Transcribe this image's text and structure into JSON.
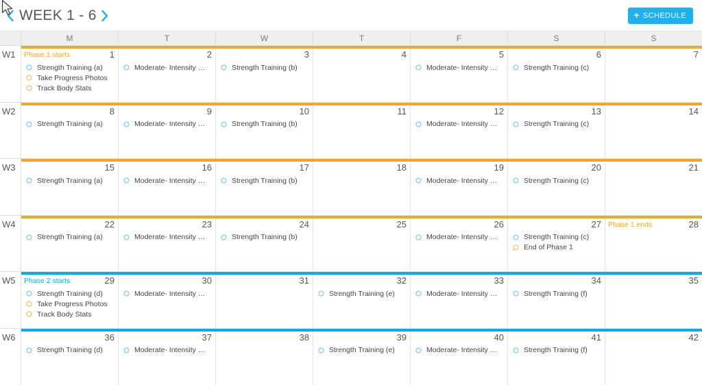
{
  "colors": {
    "phase1": "#F5A623",
    "phase2": "#00AEEF",
    "accent": "#1EB0EF",
    "task_blue": "#5BC8F5",
    "task_orange": "#F5B63F"
  },
  "header": {
    "title": "WEEK 1 - 6",
    "prev_icon": "chevron-left-icon",
    "next_icon": "chevron-right-icon",
    "schedule_label": "SCHEDULE",
    "schedule_plus": "+"
  },
  "calendar": {
    "day_headers": [
      "M",
      "T",
      "W",
      "T",
      "F",
      "S",
      "S"
    ],
    "weeks": [
      {
        "label": "W1",
        "bar_color": "#F5A623",
        "days": [
          {
            "num": "1",
            "phase_label": "Phase 1 starts",
            "phase_color": "#F5A623",
            "events": [
              {
                "label": "Strength Training (a)",
                "icon": "circle-icon",
                "color": "#5BC8F5"
              },
              {
                "label": "Take Progress Photos",
                "icon": "circle-icon",
                "color": "#F5B63F"
              },
              {
                "label": "Track Body Stats",
                "icon": "circle-icon",
                "color": "#F5B63F"
              }
            ]
          },
          {
            "num": "2",
            "events": [
              {
                "label": "Moderate- Intensity …",
                "icon": "circle-icon",
                "color": "#5BC8F5"
              }
            ]
          },
          {
            "num": "3",
            "events": [
              {
                "label": "Strength Training (b)",
                "icon": "circle-icon",
                "color": "#5BC8F5"
              }
            ]
          },
          {
            "num": "4",
            "events": []
          },
          {
            "num": "5",
            "events": [
              {
                "label": "Moderate- Intensity …",
                "icon": "circle-icon",
                "color": "#5BC8F5"
              }
            ]
          },
          {
            "num": "6",
            "events": [
              {
                "label": "Strength Training (c)",
                "icon": "circle-icon",
                "color": "#5BC8F5"
              }
            ]
          },
          {
            "num": "7",
            "events": []
          }
        ]
      },
      {
        "label": "W2",
        "bar_color": "#F5A623",
        "days": [
          {
            "num": "8",
            "events": [
              {
                "label": "Strength Training (a)",
                "icon": "circle-icon",
                "color": "#5BC8F5"
              }
            ]
          },
          {
            "num": "9",
            "events": [
              {
                "label": "Moderate- Intensity …",
                "icon": "circle-icon",
                "color": "#5BC8F5"
              }
            ]
          },
          {
            "num": "10",
            "events": [
              {
                "label": "Strength Training (b)",
                "icon": "circle-icon",
                "color": "#5BC8F5"
              }
            ]
          },
          {
            "num": "11",
            "events": []
          },
          {
            "num": "12",
            "events": [
              {
                "label": "Moderate- Intensity …",
                "icon": "circle-icon",
                "color": "#5BC8F5"
              }
            ]
          },
          {
            "num": "13",
            "events": [
              {
                "label": "Strength Training (c)",
                "icon": "circle-icon",
                "color": "#5BC8F5"
              }
            ]
          },
          {
            "num": "14",
            "events": []
          }
        ]
      },
      {
        "label": "W3",
        "bar_color": "#F5A623",
        "days": [
          {
            "num": "15",
            "events": [
              {
                "label": "Strength Training (a)",
                "icon": "circle-icon",
                "color": "#5BC8F5"
              }
            ]
          },
          {
            "num": "16",
            "events": [
              {
                "label": "Moderate- Intensity …",
                "icon": "circle-icon",
                "color": "#5BC8F5"
              }
            ]
          },
          {
            "num": "17",
            "events": [
              {
                "label": "Strength Training (b)",
                "icon": "circle-icon",
                "color": "#5BC8F5"
              }
            ]
          },
          {
            "num": "18",
            "events": []
          },
          {
            "num": "19",
            "events": [
              {
                "label": "Moderate- Intensity …",
                "icon": "circle-icon",
                "color": "#5BC8F5"
              }
            ]
          },
          {
            "num": "20",
            "events": [
              {
                "label": "Strength Training (c)",
                "icon": "circle-icon",
                "color": "#5BC8F5"
              }
            ]
          },
          {
            "num": "21",
            "events": []
          }
        ]
      },
      {
        "label": "W4",
        "bar_color": "#F5A623",
        "days": [
          {
            "num": "22",
            "events": [
              {
                "label": "Strength Training (a)",
                "icon": "circle-icon",
                "color": "#5BC8F5"
              }
            ]
          },
          {
            "num": "23",
            "events": [
              {
                "label": "Moderate- Intensity …",
                "icon": "circle-icon",
                "color": "#5BC8F5"
              }
            ]
          },
          {
            "num": "24",
            "events": [
              {
                "label": "Strength Training (b)",
                "icon": "circle-icon",
                "color": "#5BC8F5"
              }
            ]
          },
          {
            "num": "25",
            "events": []
          },
          {
            "num": "26",
            "events": [
              {
                "label": "Moderate- Intensity …",
                "icon": "circle-icon",
                "color": "#5BC8F5"
              }
            ]
          },
          {
            "num": "27",
            "events": [
              {
                "label": "Strength Training (c)",
                "icon": "circle-icon",
                "color": "#5BC8F5"
              },
              {
                "label": "End of Phase 1",
                "icon": "speech-bubble-icon",
                "color": "#F5B63F"
              }
            ]
          },
          {
            "num": "28",
            "phase_label": "Phase 1 ends",
            "phase_color": "#F5A623",
            "events": []
          }
        ]
      },
      {
        "label": "W5",
        "bar_color": "#00AEEF",
        "days": [
          {
            "num": "29",
            "phase_label": "Phase 2 starts",
            "phase_color": "#00AEEF",
            "events": [
              {
                "label": "Strength Training (d)",
                "icon": "circle-icon",
                "color": "#5BC8F5"
              },
              {
                "label": "Take Progress Photos",
                "icon": "circle-icon",
                "color": "#F5B63F"
              },
              {
                "label": "Track Body Stats",
                "icon": "circle-icon",
                "color": "#F5B63F"
              }
            ]
          },
          {
            "num": "30",
            "events": [
              {
                "label": "Moderate- Intensity …",
                "icon": "circle-icon",
                "color": "#5BC8F5"
              }
            ]
          },
          {
            "num": "31",
            "events": []
          },
          {
            "num": "32",
            "events": [
              {
                "label": "Strength Training (e)",
                "icon": "circle-icon",
                "color": "#5BC8F5"
              }
            ]
          },
          {
            "num": "33",
            "events": [
              {
                "label": "Moderate- Intensity …",
                "icon": "circle-icon",
                "color": "#5BC8F5"
              }
            ]
          },
          {
            "num": "34",
            "events": [
              {
                "label": "Strength Training (f)",
                "icon": "circle-icon",
                "color": "#5BC8F5"
              }
            ]
          },
          {
            "num": "35",
            "events": []
          }
        ]
      },
      {
        "label": "W6",
        "bar_color": "#00AEEF",
        "days": [
          {
            "num": "36",
            "events": [
              {
                "label": "Strength Training (d)",
                "icon": "circle-icon",
                "color": "#5BC8F5"
              }
            ]
          },
          {
            "num": "37",
            "events": [
              {
                "label": "Moderate- Intensity …",
                "icon": "circle-icon",
                "color": "#5BC8F5"
              }
            ]
          },
          {
            "num": "38",
            "events": []
          },
          {
            "num": "39",
            "events": [
              {
                "label": "Strength Training (e)",
                "icon": "circle-icon",
                "color": "#5BC8F5"
              }
            ]
          },
          {
            "num": "40",
            "events": [
              {
                "label": "Moderate- Intensity …",
                "icon": "circle-icon",
                "color": "#5BC8F5"
              }
            ]
          },
          {
            "num": "41",
            "events": [
              {
                "label": "Strength Training (f)",
                "icon": "circle-icon",
                "color": "#5BC8F5"
              }
            ]
          },
          {
            "num": "42",
            "events": []
          }
        ]
      }
    ]
  }
}
